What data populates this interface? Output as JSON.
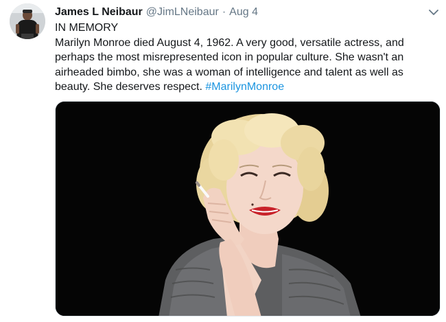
{
  "tweet": {
    "author": {
      "display_name": "James L Neibaur",
      "handle": "@JimLNeibaur",
      "separator": "·",
      "date": "Aug 4"
    },
    "body": {
      "line1": "IN MEMORY",
      "line2": "Marilyn Monroe died August 4, 1962. A very good, versatile actress, and",
      "line3": "perhaps the most misrepresented icon in popular culture. She wasn't an",
      "line4": "airheaded bimbo, she was a woman of intelligence and talent as well as",
      "line5_prefix": "beauty. She deserves respect. ",
      "hashtag": "#MarilynMonroe"
    },
    "icons": {
      "avatar": "profile-photo",
      "menu": "chevron-down-icon",
      "media": "photo-portrait"
    },
    "colors": {
      "link": "#1b95e0",
      "secondary_text": "#657786",
      "primary_text": "#14171a"
    }
  }
}
